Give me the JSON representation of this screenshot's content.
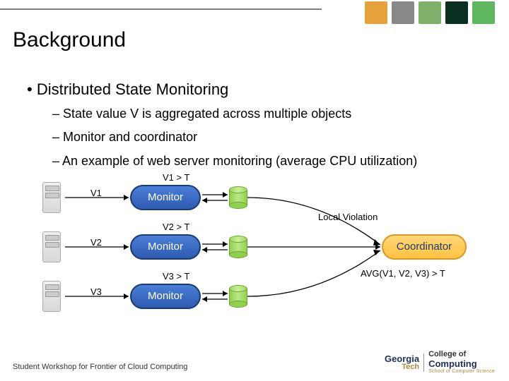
{
  "slide": {
    "title": "Background",
    "bullet": "Distributed State Monitoring",
    "subs": [
      "State value V is aggregated across multiple objects",
      "Monitor and coordinator",
      "An example of web server monitoring (average CPU utilization)"
    ],
    "footer": "Student Workshop for Frontier of Cloud Computing"
  },
  "diagram": {
    "v1": "V1",
    "v2": "V2",
    "v3": "V3",
    "c1": "V1 > T",
    "c2": "V2 > T",
    "c3": "V3 > T",
    "monitor": "Monitor",
    "coordinator": "Coordinator",
    "local_violation": "Local Violation",
    "avg": "AVG(V1, V2, V3) > T"
  },
  "logo": {
    "gt1": "Georgia",
    "gt2": "Tech",
    "cc1": "College of",
    "cc2": "Computing",
    "cc3": "School of Computer Science"
  }
}
